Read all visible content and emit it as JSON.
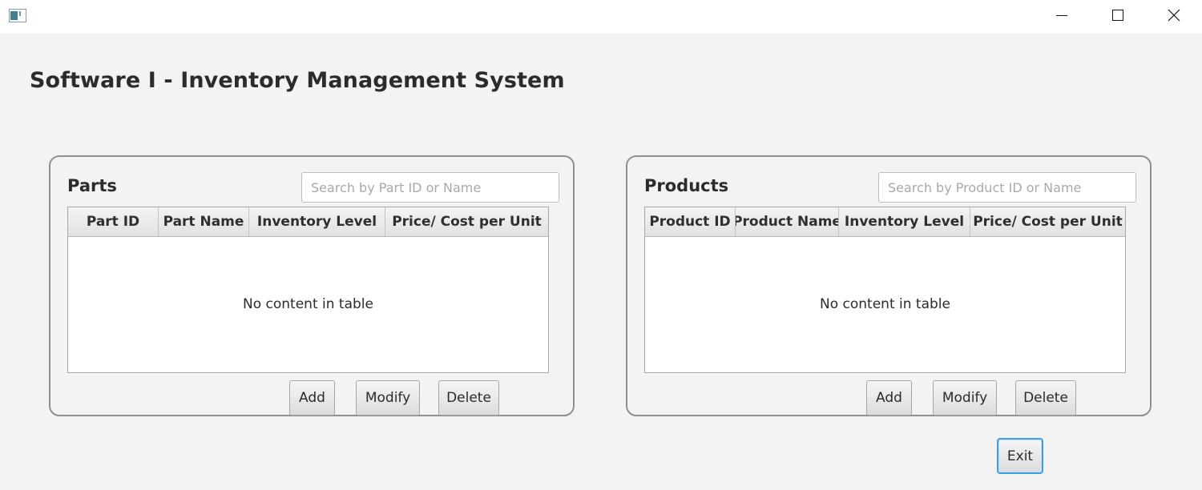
{
  "window": {
    "app_icon": "java-app-icon",
    "controls": {
      "minimize_icon": "minimize-icon",
      "maximize_icon": "maximize-icon",
      "close_icon": "close-icon"
    }
  },
  "heading": "Software I - Inventory Management System",
  "parts": {
    "title": "Parts",
    "search_placeholder": "Search by Part ID or Name",
    "columns": [
      "Part ID",
      "Part Name",
      "Inventory Level",
      "Price/ Cost per Unit"
    ],
    "rows": [],
    "empty_message": "No content in table",
    "buttons": {
      "add": "Add",
      "modify": "Modify",
      "delete": "Delete"
    }
  },
  "products": {
    "title": "Products",
    "search_placeholder": "Search by Product ID or Name",
    "columns": [
      "Product ID",
      "Product Name",
      "Inventory Level",
      "Price/ Cost per Unit"
    ],
    "rows": [],
    "empty_message": "No content in table",
    "buttons": {
      "add": "Add",
      "modify": "Modify",
      "delete": "Delete"
    }
  },
  "exit_label": "Exit",
  "colors": {
    "background": "#f3f3f3",
    "focus_border": "#3d9ee6"
  }
}
